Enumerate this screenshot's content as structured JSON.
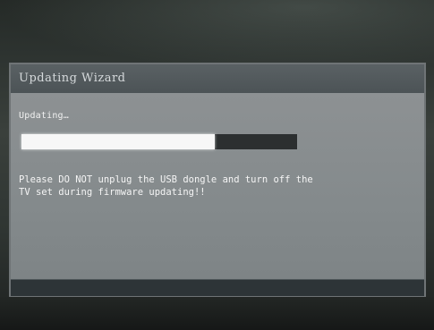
{
  "wizard": {
    "title": "Updating Wizard",
    "status_text": "Updating…",
    "progress_percent": 70,
    "warning_line1": "Please DO NOT unplug the USB dongle and turn off the",
    "warning_line2": "TV set during firmware updating!!"
  },
  "colors": {
    "panel_background": "#878b8d",
    "titlebar_background": "#4f5659",
    "progress_fill": "#f7f7f7",
    "progress_track": "#2c2f30",
    "text": "#f5f5f5"
  }
}
